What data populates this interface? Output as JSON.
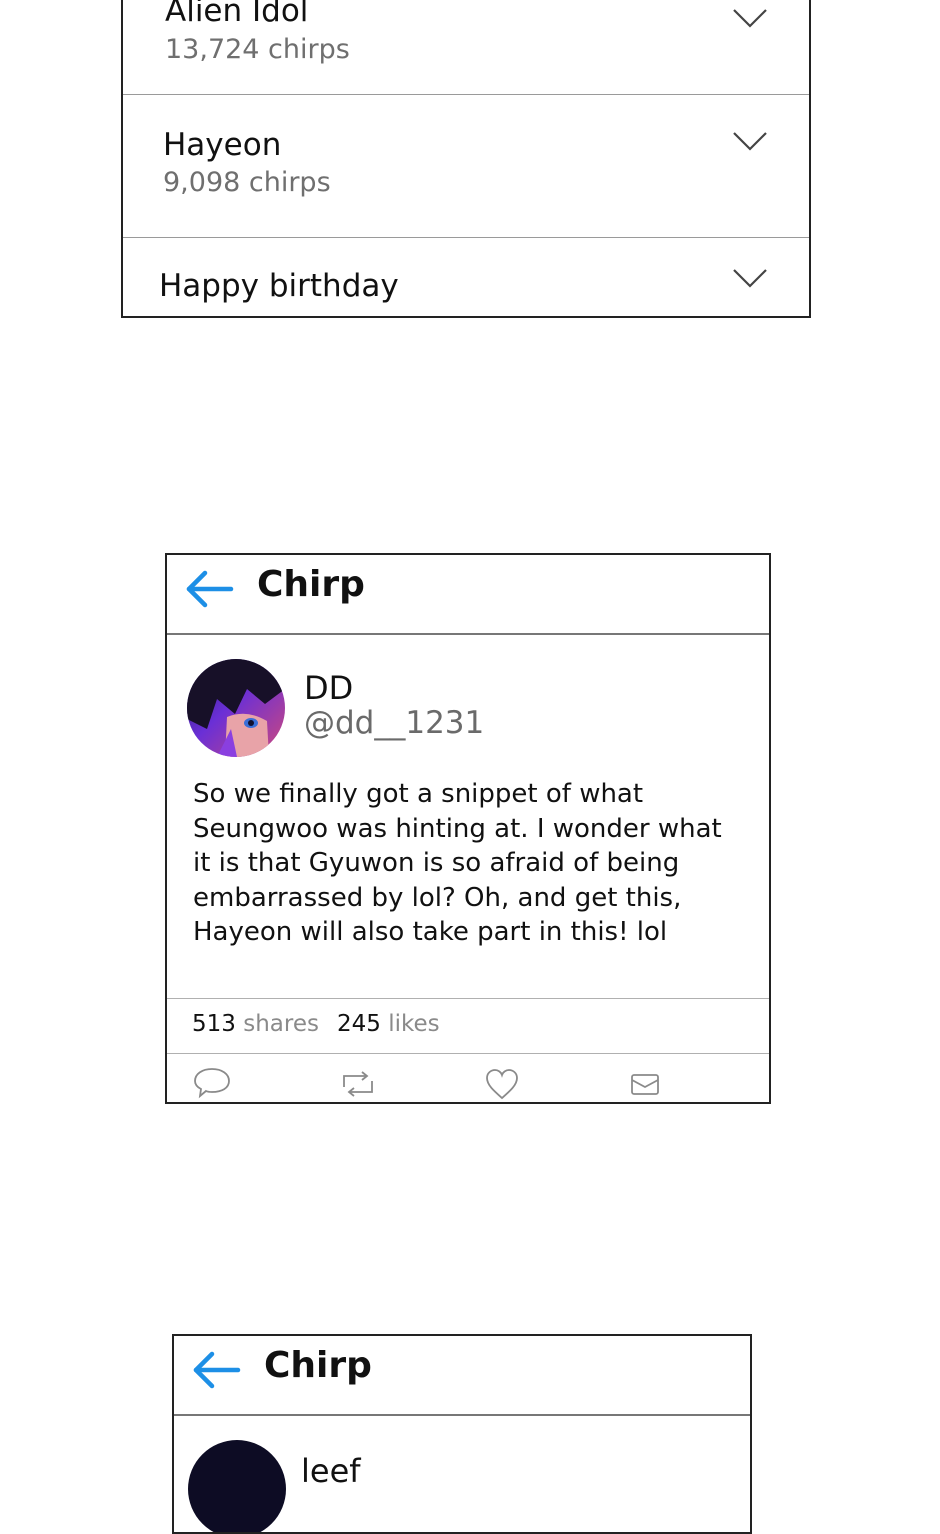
{
  "trends": [
    {
      "title": "Alien Idol",
      "count": "13,724 chirps"
    },
    {
      "title": "Hayeon",
      "count": "9,098 chirps"
    },
    {
      "title": "Happy birthday",
      "count": ""
    }
  ],
  "colors": {
    "accent": "#1d8fe6",
    "border": "#222222",
    "muted": "#6f6f6f"
  },
  "icons": {
    "back": "arrow-left-icon",
    "expand": "chevron-down-icon",
    "reply": "speech-bubble-icon",
    "rechirp": "repost-icon",
    "like": "heart-icon",
    "message": "envelope-icon"
  },
  "chirp_card_1": {
    "header_title": "Chirp",
    "author_name": "DD",
    "author_handle": "@dd__1231",
    "text_lines": [
      "So we finally got a snippet of what",
      "Seungwoo was hinting at. I wonder what",
      "it is that Gyuwon is so afraid of being",
      "embarrassed by lol? Oh, and get this,",
      "Hayeon will also take part in this! lol"
    ],
    "shares_count": "513",
    "shares_label": "shares",
    "likes_count": "245",
    "likes_label": "likes"
  },
  "chirp_card_2": {
    "header_title": "Chirp",
    "author_name": "leef"
  }
}
